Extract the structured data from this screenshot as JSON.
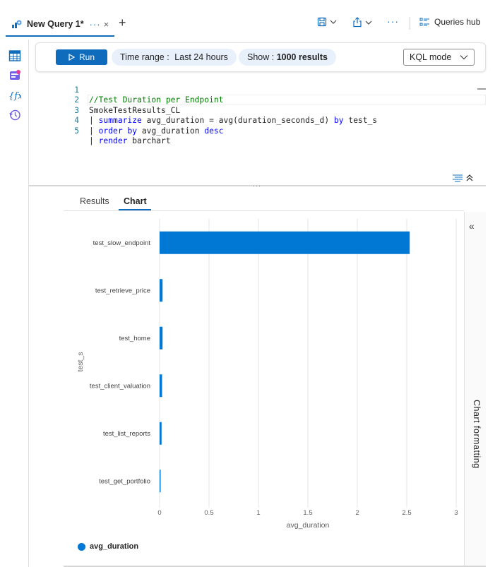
{
  "tab": {
    "title": "New Query 1*",
    "dots": "···",
    "close": "×",
    "add": "+"
  },
  "toolbar": {
    "more": "···",
    "hub_label": "Queries hub"
  },
  "query_bar": {
    "run_label": "Run",
    "time_range_label": "Time range : ",
    "time_range_value": "Last 24 hours",
    "show_label": "Show : ",
    "show_value": "1000 results",
    "mode_label": "KQL mode"
  },
  "editor": {
    "lines": [
      {
        "num": "1",
        "text": "//Test Duration per Endpoint"
      },
      {
        "num": "2",
        "text": "SmokeTestResults_CL"
      },
      {
        "num": "3",
        "text": "| summarize avg_duration = avg(duration_seconds_d) by test_s"
      },
      {
        "num": "4",
        "text": "| order by avg_duration desc"
      },
      {
        "num": "5",
        "text": "| render barchart"
      }
    ]
  },
  "results": {
    "tab_results": "Results",
    "tab_chart": "Chart"
  },
  "side_panel": {
    "label": "Chart formatting",
    "collapse": "«"
  },
  "colors": {
    "accent": "#0f6cbd",
    "bar": "#0078d4"
  },
  "chart_data": {
    "type": "bar",
    "orientation": "horizontal",
    "categories": [
      "test_slow_endpoint",
      "test_retrieve_price",
      "test_home",
      "test_client_valuation",
      "test_list_reports",
      "test_get_portfolio"
    ],
    "series": [
      {
        "name": "avg_duration",
        "values": [
          2.53,
          0.03,
          0.03,
          0.025,
          0.02,
          0.005
        ]
      }
    ],
    "xlabel": "avg_duration",
    "ylabel": "test_s",
    "xlim": [
      0,
      3
    ],
    "xticks": [
      "0",
      "0.5",
      "1",
      "1.5",
      "2",
      "2.5",
      "3"
    ],
    "grid": true,
    "legend": "bottom-left"
  }
}
